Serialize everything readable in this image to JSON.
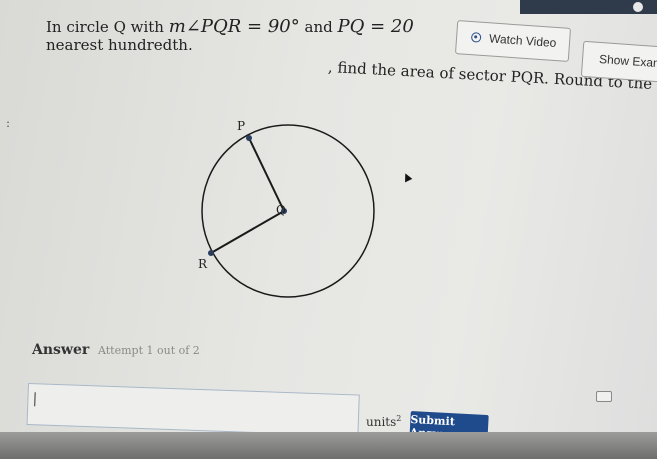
{
  "question": {
    "part1": "In circle Q with ",
    "math1": "m∠PQR = 90°",
    "part2": " and ",
    "math2": "PQ = 20",
    "part3": ", find the area of sector PQR. Round to the",
    "line2": "nearest hundredth."
  },
  "buttons": {
    "watch_video": "Watch Video",
    "show_example": "Show Examp"
  },
  "diagram": {
    "labels": {
      "p": "P",
      "q": "Q",
      "r": "R"
    }
  },
  "answer": {
    "label": "Answer",
    "attempt": "Attempt 1 out of 2",
    "value": "",
    "units": "units",
    "units_exp": "2",
    "submit": "Submit Answer"
  }
}
